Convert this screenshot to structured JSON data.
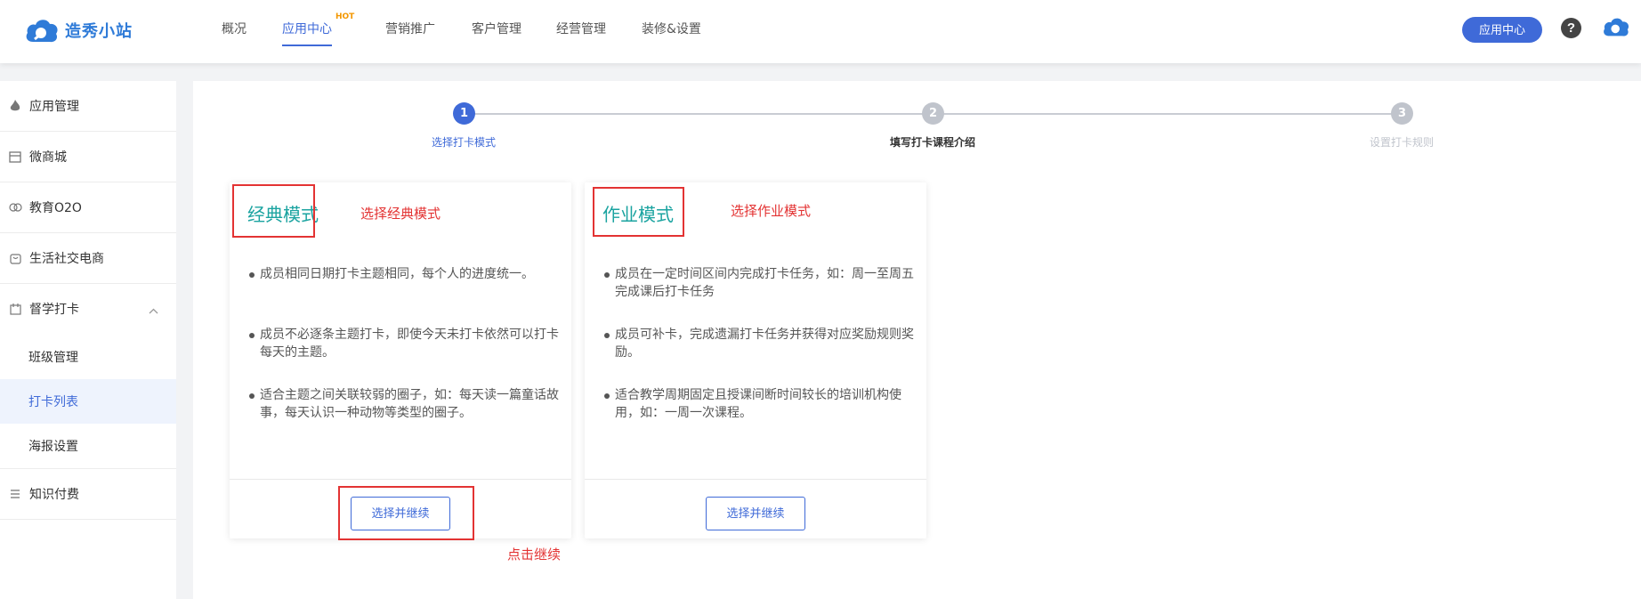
{
  "header": {
    "logo_text": "造秀小站",
    "nav": [
      {
        "label": "概况"
      },
      {
        "label": "应用中心",
        "badge": "HOT"
      },
      {
        "label": "营销推广"
      },
      {
        "label": "客户管理"
      },
      {
        "label": "经营管理"
      },
      {
        "label": "装修&设置"
      }
    ],
    "app_center_button": "应用中心",
    "help_symbol": "?"
  },
  "sidebar": {
    "items": [
      {
        "label": "应用管理",
        "icon": "flame-icon"
      },
      {
        "label": "微商城",
        "icon": "store-icon"
      },
      {
        "label": "教育O2O",
        "icon": "handshake-icon"
      },
      {
        "label": "生活社交电商",
        "icon": "bag-icon"
      },
      {
        "label": "督学打卡",
        "icon": "calendar-icon"
      }
    ],
    "sub_items": [
      {
        "label": "班级管理"
      },
      {
        "label": "打卡列表"
      },
      {
        "label": "海报设置"
      }
    ],
    "bottom_item": {
      "label": "知识付费",
      "icon": "list-icon"
    }
  },
  "steps": [
    {
      "number": "1",
      "label": "选择打卡模式",
      "state": "active"
    },
    {
      "number": "2",
      "label": "填写打卡课程介绍",
      "state": "next"
    },
    {
      "number": "3",
      "label": "设置打卡规则",
      "state": "pending"
    }
  ],
  "cards": [
    {
      "title": "经典模式",
      "bullets": [
        "成员相同日期打卡主题相同，每个人的进度统一。",
        "成员不必逐条主题打卡，即使今天未打卡依然可以打卡每天的主题。",
        "适合主题之间关联较弱的圈子，如：每天读一篇童话故事，每天认识一种动物等类型的圈子。"
      ],
      "button": "选择并继续"
    },
    {
      "title": "作业模式",
      "bullets": [
        "成员在一定时间区间内完成打卡任务，如：周一至周五完成课后打卡任务",
        "成员可补卡，完成遗漏打卡任务并获得对应奖励规则奖励。",
        "适合教学周期固定且授课间断时间较长的培训机构使用，如：一周一次课程。"
      ],
      "button": "选择并继续"
    }
  ],
  "annotations": {
    "classic_note": "选择经典模式",
    "homework_note": "选择作业模式",
    "continue_note": "点击继续"
  },
  "colors": {
    "accent": "#3f6ad8",
    "title_teal": "#1aa3a0",
    "annotation_red": "#e33333",
    "step_pending": "#c0c4cc"
  }
}
